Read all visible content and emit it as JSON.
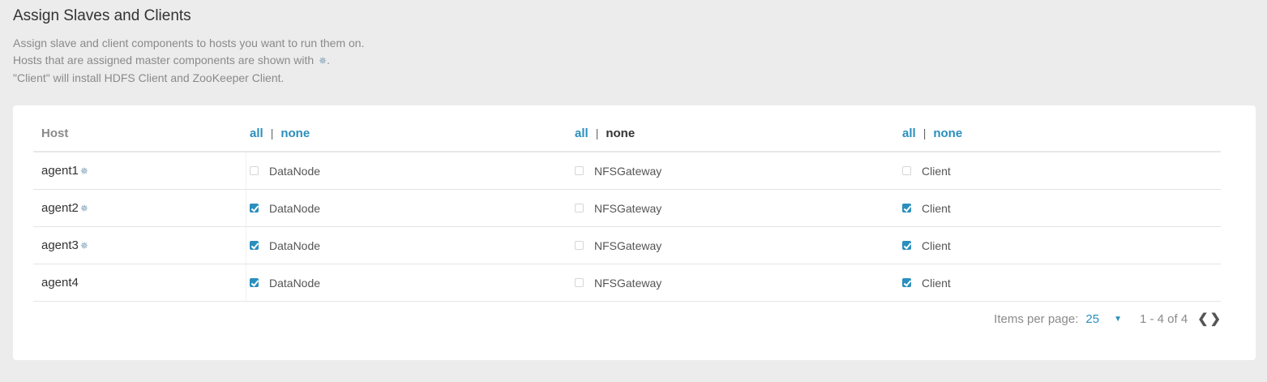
{
  "page": {
    "title": "Assign Slaves and Clients",
    "description": {
      "line1": "Assign slave and client components to hosts you want to run them on.",
      "line2_prefix": "Hosts that are assigned master components are shown with",
      "line2_suffix": ".",
      "line3": "\"Client\" will install HDFS Client and ZooKeeper Client.",
      "master_icon": "✵"
    }
  },
  "table": {
    "host_header": "Host",
    "columns": [
      {
        "all_label": "all",
        "separator": "|",
        "none_label": "none",
        "component": "DataNode"
      },
      {
        "all_label": "all",
        "separator": "|",
        "none_label": "none",
        "component": "NFSGateway"
      },
      {
        "all_label": "all",
        "separator": "|",
        "none_label": "none",
        "component": "Client"
      }
    ],
    "rows": [
      {
        "host": "agent1",
        "master_icon": "✵",
        "datanode": false,
        "nfsgateway": false,
        "client": false
      },
      {
        "host": "agent2",
        "master_icon": "✵",
        "datanode": true,
        "nfsgateway": false,
        "client": true
      },
      {
        "host": "agent3",
        "master_icon": "✵",
        "datanode": true,
        "nfsgateway": false,
        "client": true
      },
      {
        "host": "agent4",
        "master_icon": "",
        "datanode": true,
        "nfsgateway": false,
        "client": true
      }
    ]
  },
  "pagination": {
    "items_per_page_label": "Items per page:",
    "items_per_page_value": "25",
    "dropdown_icon": "▼",
    "range": "1 - 4 of 4",
    "prev_icon": "❮",
    "next_icon": "❯"
  },
  "colors": {
    "accent": "#2a8fbd",
    "background": "#ececec",
    "card": "#ffffff"
  }
}
